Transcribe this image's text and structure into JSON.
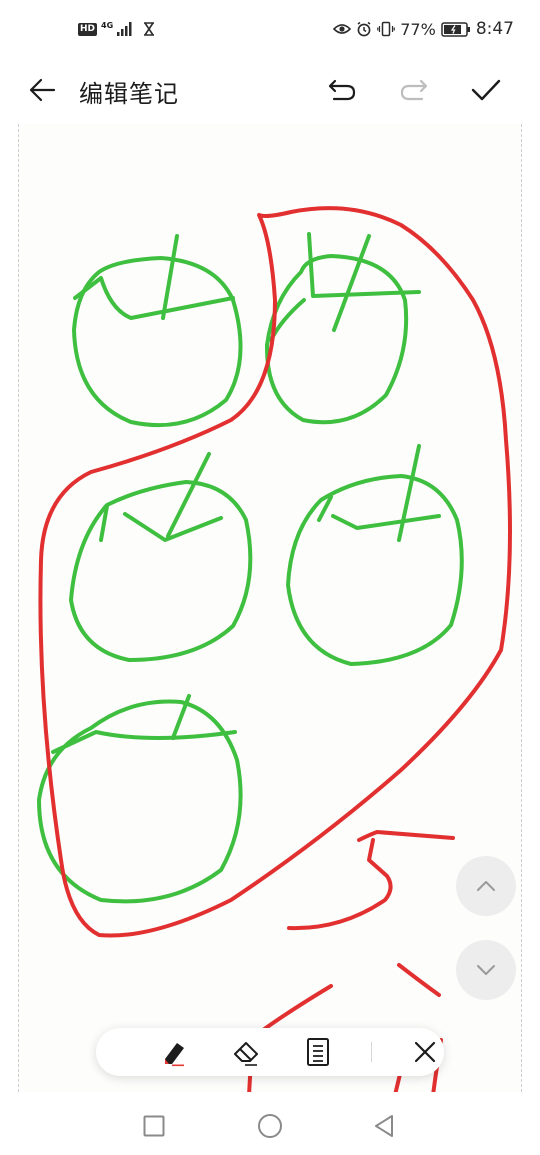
{
  "status_bar": {
    "hd_label": "HD",
    "network_label": "4G",
    "battery_percent": "77%",
    "time": "8:47",
    "icons": [
      "signal-icon",
      "hourglass-icon",
      "eye-icon",
      "alarm-icon",
      "vibrate-icon",
      "battery-icon"
    ]
  },
  "header": {
    "title": "编辑笔记",
    "icons": [
      "back-arrow-icon",
      "undo-icon",
      "redo-icon",
      "check-icon"
    ]
  },
  "colors": {
    "pen_green": "#3fbf3f",
    "pen_red": "#e23030",
    "accent_red": "#e53935"
  },
  "scroll_buttons": [
    "chevron-up-icon",
    "chevron-down-icon"
  ],
  "toolbar": {
    "tools": [
      "pen-icon",
      "eraser-icon",
      "document-icon",
      "close-icon"
    ]
  },
  "nav_bar": {
    "buttons": [
      "recents-square-icon",
      "home-circle-icon",
      "back-triangle-icon"
    ]
  }
}
